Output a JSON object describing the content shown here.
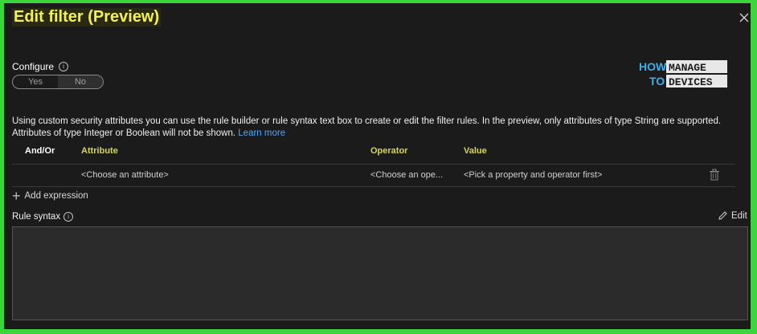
{
  "dialog": {
    "title": "Edit filter (Preview)"
  },
  "configure": {
    "label": "Configure",
    "toggle": {
      "options": [
        "Yes",
        "No"
      ],
      "selected": "No"
    }
  },
  "logo": {
    "line1_left": "HOW",
    "line1_right": "MANAGE",
    "line2_left": "TO",
    "line2_right": "DEVICES"
  },
  "description": {
    "text": "Using custom security attributes you can use the rule builder or rule syntax text box to create or edit the filter rules. In the preview, only attributes of type String are supported. Attributes of type Integer or Boolean will not be shown.",
    "link": "Learn more"
  },
  "table": {
    "columns": [
      "And/Or",
      "Attribute",
      "Operator",
      "Value"
    ],
    "rows": [
      {
        "andor": "",
        "attribute": "<Choose an attribute>",
        "operator": "<Choose an ope...",
        "value": "<Pick a property and operator first>"
      }
    ]
  },
  "add_expression": {
    "label": "Add expression"
  },
  "rule_syntax": {
    "label": "Rule syntax",
    "edit_label": "Edit",
    "value": ""
  },
  "colors": {
    "title": "#f3f05a",
    "column_header": "#d6d45a",
    "link": "#4aa7ff",
    "background": "#1b1b1b",
    "frame": "#3cd63c"
  }
}
